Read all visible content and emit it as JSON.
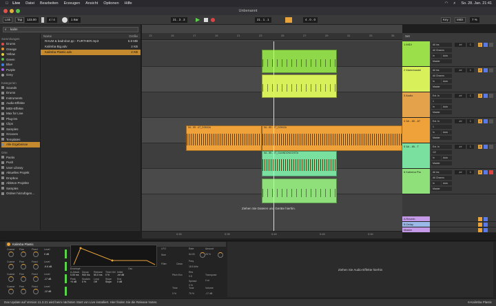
{
  "menubar": {
    "app": "Live",
    "items": [
      "Datei",
      "Bearbeiten",
      "Erzeugen",
      "Ansicht",
      "Optionen",
      "Hilfe"
    ],
    "datetime": "So. 28. Jan.  21:41"
  },
  "window": {
    "title": "Unbenannt"
  },
  "transport": {
    "link": "Link",
    "tap": "Tap",
    "tempo": "123.00",
    "signature": "4 / 4",
    "metronome": "1 Bar",
    "position": "21 .  3 .  3",
    "loop_start": "21 .  1 .  1",
    "loop_length": "4 .  0 .  0",
    "key": "Key",
    "midi": "MIDI",
    "cpu": "7 %"
  },
  "browser": {
    "search_value": "kalim",
    "collections_header": "Sammlungen",
    "collections": [
      {
        "label": "Drums",
        "color": "#e34a4a"
      },
      {
        "label": "Orange",
        "color": "#e8902e"
      },
      {
        "label": "Yellow",
        "color": "#e8d23a"
      },
      {
        "label": "Green",
        "color": "#58c24a"
      },
      {
        "label": "Blue",
        "color": "#3a7ee8"
      },
      {
        "label": "Purple",
        "color": "#a55ae8"
      },
      {
        "label": "Grey",
        "color": "#9a9a9a"
      }
    ],
    "categories_header": "Kategorien",
    "categories": [
      "Sounds",
      "Drums",
      "Instruments",
      "Audio-Effekte",
      "MIDI-Effekte",
      "Max for Live",
      "Plug-ins",
      "Clips",
      "Samples",
      "Grooves",
      "Templates",
      "Alle Ergebnisse"
    ],
    "places_header": "Orte",
    "places": [
      "Packs",
      "Push",
      "User Library",
      "Aktuelles Projekt",
      "Dropbox",
      "Ableton Projekte",
      "Samples",
      "Ordner hinzufügen..."
    ],
    "columns": {
      "name": "Name",
      "size": "Größe"
    },
    "files": [
      {
        "name": "RAUM & badrobot.pp - FURTHER.mp3",
        "size": "5.8 MB"
      },
      {
        "name": "Kalimba Big.adv",
        "size": "2 KB"
      },
      {
        "name": "Kalimba Plastic.adv",
        "size": "2 KB"
      }
    ]
  },
  "ruler": [
    "13",
    "15",
    "17",
    "19",
    "21",
    "23",
    "25",
    "27",
    "29",
    "31",
    "33",
    "35"
  ],
  "arrangement": {
    "audio_clip_label": "5A - 85 - AT_DONGA",
    "audio_clip_label2": "5A - 85 - AT_DONGA",
    "green_clip_label": "5A - 85 - AT_GUANDONGOSTA",
    "drop_hint": "Ziehen Sie Dateien und Geräte hierhin.",
    "timeline": [
      "0:30",
      "0:35",
      "0:40",
      "0:45",
      "0:50"
    ]
  },
  "tracks": [
    {
      "name": "1 MIDI",
      "color": "#9be04a",
      "input": "All Ins",
      "channel": "All Channs",
      "monitor": "In",
      "auto": "Auto",
      "off": "Off",
      "out": "Master",
      "vol": "-inf",
      "pan": "C",
      "num": "1"
    },
    {
      "name": "2 Marimbastel",
      "color": "#d8f05a",
      "input": "All Ins",
      "channel": "All Channs",
      "monitor": "In",
      "auto": "Auto",
      "off": "Off",
      "out": "Master",
      "vol": "-inf",
      "pan": "C",
      "num": "2"
    },
    {
      "name": "3 Audio",
      "color": "#e4a24a",
      "input": "Ext. In",
      "channel": "1",
      "monitor": "In",
      "auto": "Auto",
      "off": "Off",
      "out": "Master",
      "vol": "-inf",
      "pan": "C",
      "num": "3"
    },
    {
      "name": "4 5A - 85 - AT",
      "color": "#f0a23a",
      "input": "Ext. In",
      "channel": "1",
      "monitor": "In",
      "auto": "Auto",
      "off": "Off",
      "out": "Master",
      "vol": "-inf",
      "pan": "C",
      "num": "4"
    },
    {
      "name": "5 5A - 85 - T",
      "color": "#7ae0a0",
      "input": "Ext. In",
      "channel": "1/2",
      "monitor": "In",
      "auto": "Auto",
      "off": "Off",
      "out": "Master",
      "vol": "-inf",
      "pan": "C",
      "num": "5"
    },
    {
      "name": "6 Kalimba Pla",
      "color": "#8fe07a",
      "input": "All Ins",
      "channel": "All Channs",
      "monitor": "In",
      "auto": "Auto",
      "off": "Off",
      "out": "Master",
      "vol": "-inf",
      "pan": "C",
      "num": "6"
    }
  ],
  "returns": [
    {
      "name": "A Reverb",
      "color": "#c49ae8"
    },
    {
      "name": "B Delay",
      "color": "#9ab8e8"
    },
    {
      "name": "Master",
      "color": "#c49ae8"
    }
  ],
  "set_label": "Set",
  "device": {
    "name": "Kalimba Plastic",
    "ops": [
      {
        "coarse": "Coarse",
        "fine": "Fine",
        "fixed": "Fixed",
        "level": "Level",
        "val": "0 dB"
      },
      {
        "coarse": "Coarse",
        "fine": "Fine",
        "fixed": "Fixed",
        "level": "Level",
        "val": "-9.6 dB"
      },
      {
        "coarse": "Coarse",
        "fine": "Fine",
        "fixed": "Fixed",
        "level": "Level",
        "val": "-17 dB"
      },
      {
        "coarse": "Coarse",
        "fine": "Fine",
        "fixed": "Fixed",
        "level": "Level",
        "val": "-12 dB"
      }
    ],
    "envelope_label": "Envelope",
    "env_params": [
      "A-Attack",
      "Decay",
      "Release",
      "Time<Vel",
      "Initial",
      "Peak",
      "Sustain",
      "Loop",
      "Slope",
      "End"
    ],
    "env_values": [
      "0.00 ms",
      "900 ms",
      "50.0 ms",
      "0 %",
      "-inf dB",
      "+0 dB",
      "0 %",
      "Off",
      "Slope",
      "0 dB"
    ],
    "osc_label": "Osc",
    "lfo_label": "LFO",
    "lfo_wave": "Sine",
    "lfo_rate": "Rate",
    "lfo_amount": "Amount",
    "filter_label": "Filter",
    "filter_type": "Clean",
    "freq": "Freq",
    "res": "Res",
    "pitch_env": "Pitch Env",
    "spread": "Spread",
    "transpose": "Transpose",
    "time": "Time",
    "tone": "Tone",
    "volume": "Volume",
    "vals": {
      "rate": "64.00",
      "amount": "25 %",
      "freq": "18.5 kHz",
      "res": "0.5",
      "spread": "0 %",
      "transpose": "0 st",
      "time": "0 %",
      "tone": "75 %",
      "volume": "-17 dB"
    }
  },
  "fx_drop_hint": "Ziehen Sie Audio-Effekte hierhin",
  "status": {
    "message": "Das Update auf Version 11.3.21 wird beim nächsten Start von Live installiert. Hier finden Sie die Release Notes.",
    "right": "6-Kalimba Plastic"
  }
}
